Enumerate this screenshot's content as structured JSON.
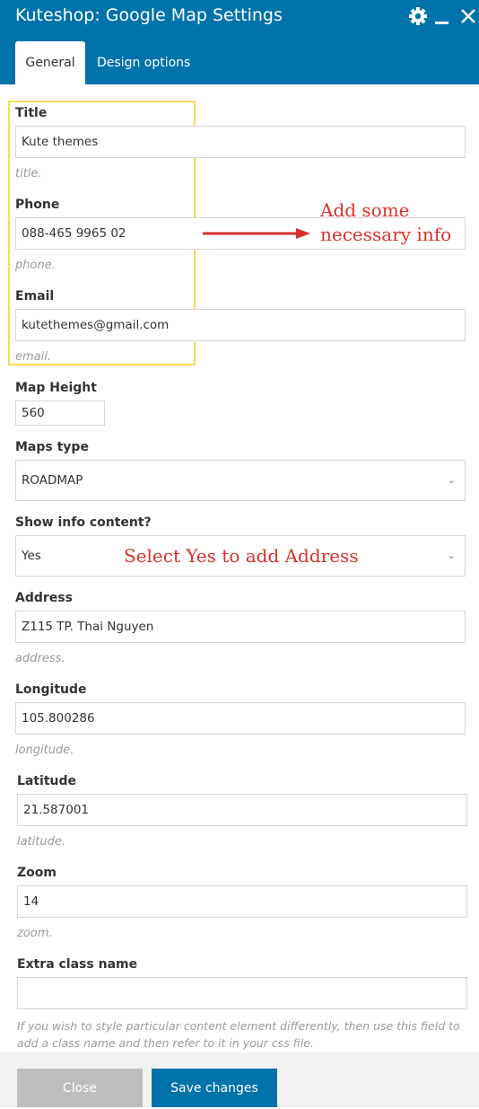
{
  "window": {
    "title": "Kuteshop: Google Map Settings"
  },
  "tabs": {
    "general": "General",
    "design": "Design options"
  },
  "fields": {
    "title": {
      "label": "Title",
      "value": "Kute themes",
      "help": "title."
    },
    "phone": {
      "label": "Phone",
      "value": "088-465 9965 02",
      "help": "phone."
    },
    "email": {
      "label": "Email",
      "value": "kutethemes@gmail.com",
      "help": "email."
    },
    "map_height": {
      "label": "Map Height",
      "value": "560"
    },
    "maps_type": {
      "label": "Maps type",
      "value": "ROADMAP"
    },
    "show_info": {
      "label": "Show info content?",
      "value": "Yes"
    },
    "address": {
      "label": "Address",
      "value": "Z115 TP. Thai Nguyen",
      "help": "address."
    },
    "longitude": {
      "label": "Longitude",
      "value": "105.800286",
      "help": "longitude."
    },
    "latitude": {
      "label": "Latitude",
      "value": "21.587001",
      "help": "latitude."
    },
    "zoom": {
      "label": "Zoom",
      "value": "14",
      "help": "zoom."
    },
    "extra_class": {
      "label": "Extra class name",
      "value": "",
      "help": "If you wish to style particular content element differently, then use this field to add a class name and then refer to it in your css file."
    }
  },
  "annotations": {
    "add_info_line1": "Add some",
    "add_info_line2": "necessary info",
    "select_yes": "Select Yes to add Address"
  },
  "buttons": {
    "close": "Close",
    "save": "Save changes"
  },
  "colors": {
    "accent": "#0073aa",
    "annotation": "#d9312c",
    "highlight": "#f4dd57"
  }
}
